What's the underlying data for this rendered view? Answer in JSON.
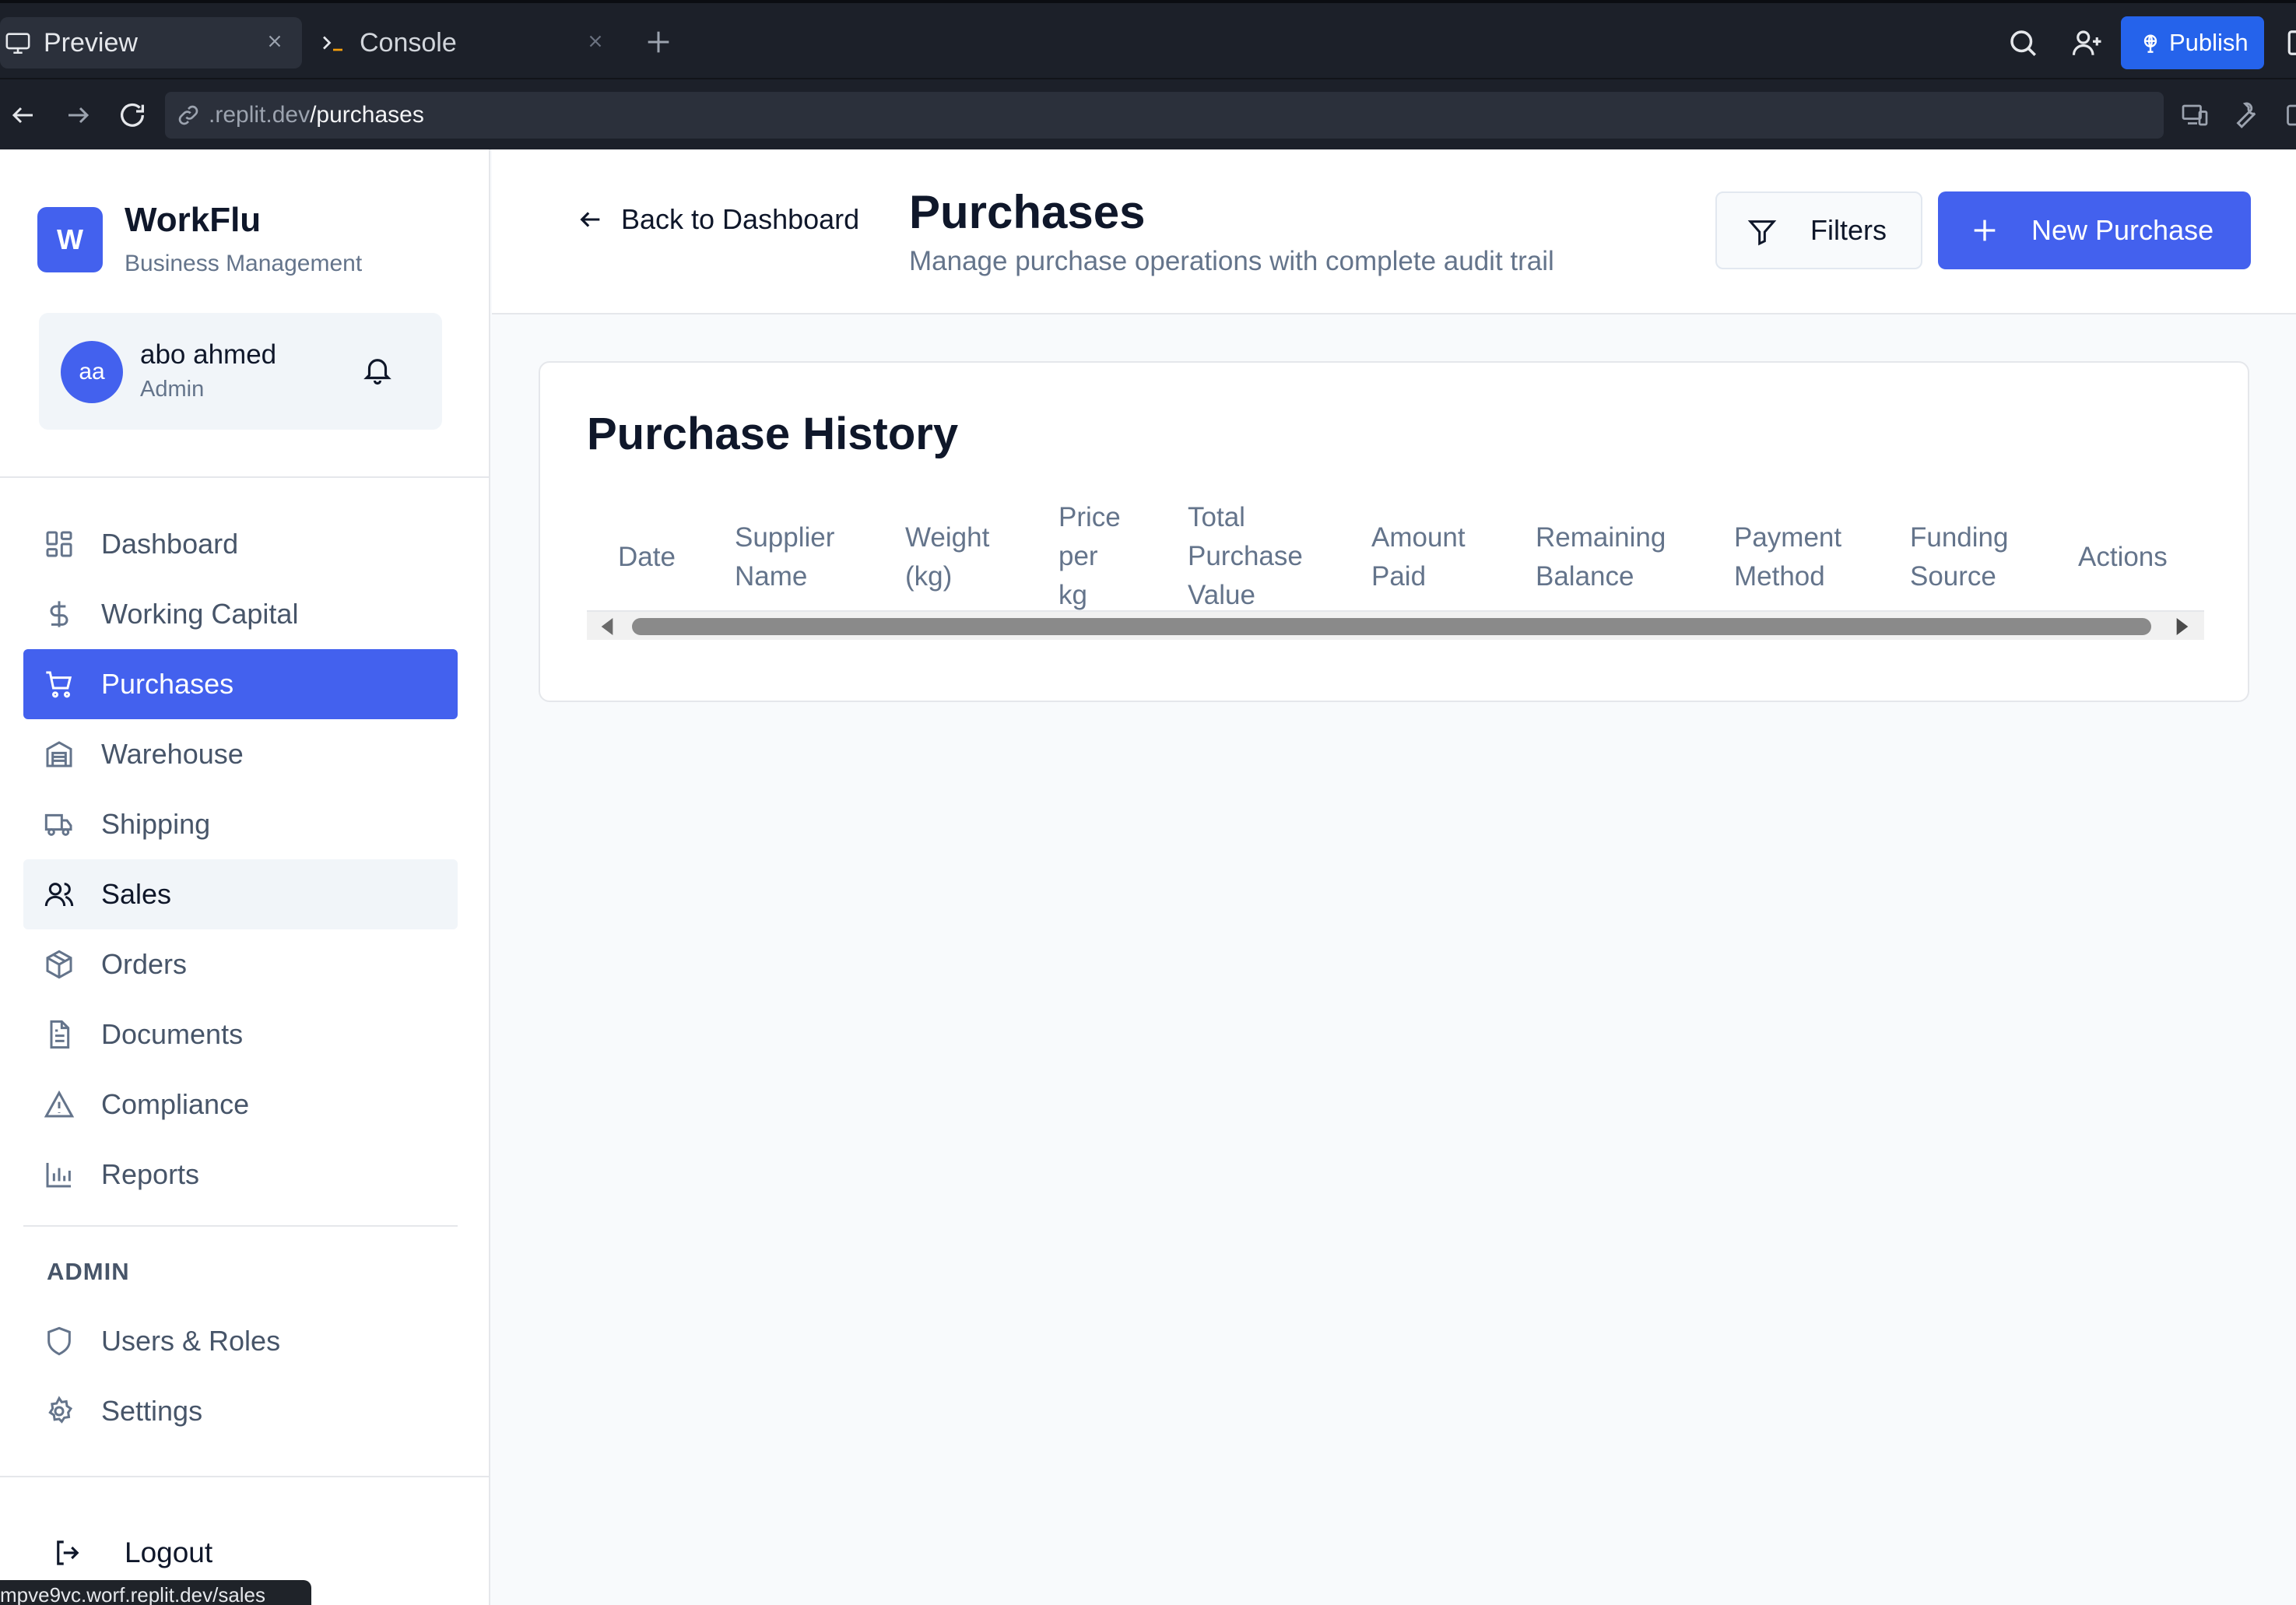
{
  "browser": {
    "tabs": [
      {
        "label": "Preview",
        "icon": "monitor-icon",
        "active": true
      },
      {
        "label": "Console",
        "icon": "terminal-icon",
        "active": false
      }
    ],
    "publish_label": "Publish",
    "url": {
      "host": ".replit.dev",
      "path": "/purchases"
    },
    "status_link": "mpve9vc.worf.replit.dev/sales"
  },
  "sidebar": {
    "logo_letter": "W",
    "brand": "WorkFlu",
    "brand_sub": "Business Management",
    "user": {
      "initials": "aa",
      "name": "abo ahmed",
      "role": "Admin"
    },
    "nav": [
      {
        "label": "Dashboard",
        "icon": "grid-icon"
      },
      {
        "label": "Working Capital",
        "icon": "dollar-icon"
      },
      {
        "label": "Purchases",
        "icon": "cart-icon",
        "active": true
      },
      {
        "label": "Warehouse",
        "icon": "warehouse-icon"
      },
      {
        "label": "Shipping",
        "icon": "truck-icon"
      },
      {
        "label": "Sales",
        "icon": "users-icon",
        "hover": true
      },
      {
        "label": "Orders",
        "icon": "package-icon"
      },
      {
        "label": "Documents",
        "icon": "file-icon"
      },
      {
        "label": "Compliance",
        "icon": "warning-icon"
      },
      {
        "label": "Reports",
        "icon": "bar-chart-icon"
      }
    ],
    "admin_heading": "ADMIN",
    "admin_nav": [
      {
        "label": "Users & Roles",
        "icon": "shield-icon"
      },
      {
        "label": "Settings",
        "icon": "gear-icon"
      }
    ],
    "logout_label": "Logout"
  },
  "header": {
    "back_label": "Back to Dashboard",
    "title": "Purchases",
    "subtitle": "Manage purchase operations with complete audit trail",
    "filters_label": "Filters",
    "new_label": "New Purchase"
  },
  "card": {
    "title": "Purchase History",
    "columns": [
      [
        "Date"
      ],
      [
        "Supplier",
        "Name"
      ],
      [
        "Weight",
        "(kg)"
      ],
      [
        "Price",
        "per",
        "kg"
      ],
      [
        "Total",
        "Purchase",
        "Value"
      ],
      [
        "Amount",
        "Paid"
      ],
      [
        "Remaining",
        "Balance"
      ],
      [
        "Payment",
        "Method"
      ],
      [
        "Funding",
        "Source"
      ],
      [
        "Actions"
      ]
    ]
  },
  "colors": {
    "accent": "#4361ee",
    "chrome": "#1c2029",
    "publish": "#2563eb"
  }
}
